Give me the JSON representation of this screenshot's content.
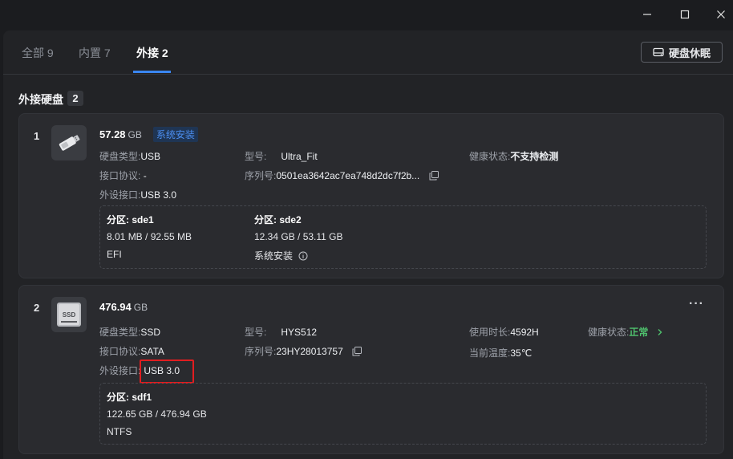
{
  "window": {
    "minimize_glyph": "—",
    "maximize_glyph": "☐",
    "close_glyph": "✕"
  },
  "tabs": [
    {
      "label": "全部 9"
    },
    {
      "label": "内置 7"
    },
    {
      "label": "外接 2"
    }
  ],
  "toolbar": {
    "sleep_label": "硬盘休眠",
    "sleep_icon": "drive-icon"
  },
  "section": {
    "title": "外接硬盘",
    "count": "2"
  },
  "drives": [
    {
      "index": "1",
      "size": "57.28",
      "unit": "GB",
      "badge": "系统安装",
      "icon": "usb-stick-icon",
      "disk_type_label": "硬盘类型:",
      "disk_type": "USB",
      "protocol_label": "接口协议:",
      "protocol": "-",
      "port_label": "外设接口:",
      "port": "USB 3.0",
      "model_label": "型号:",
      "model": "Ultra_Fit",
      "serial_label": "序列号:",
      "serial": "0501ea3642ac7ea748d2dc7f2b...",
      "health_label": "健康状态:",
      "health": "不支持检测",
      "partitions": [
        {
          "name_label": "分区:",
          "name": "sde1",
          "usage": "8.01 MB / 92.55 MB",
          "fs": "EFI"
        },
        {
          "name_label": "分区:",
          "name": "sde2",
          "usage": "12.34 GB / 53.11 GB",
          "fs": "系统安装"
        }
      ]
    },
    {
      "index": "2",
      "size": "476.94",
      "unit": "GB",
      "icon": "ssd-icon",
      "icon_text": "SSD",
      "disk_type_label": "硬盘类型:",
      "disk_type": "SSD",
      "protocol_label": "接口协议:",
      "protocol": "SATA",
      "port_label": "外设接口:",
      "port": "USB 3.0",
      "model_label": "型号:",
      "model": "HYS512",
      "serial_label": "序列号:",
      "serial": "23HY28013757",
      "uptime_label": "使用时长:",
      "uptime": "4592H",
      "temp_label": "当前温度:",
      "temp": "35℃",
      "health_label": "健康状态:",
      "health": "正常",
      "more": "···",
      "partitions": [
        {
          "name_label": "分区:",
          "name": "sdf1",
          "usage": "122.65 GB / 476.94 GB",
          "fs": "NTFS"
        }
      ]
    }
  ],
  "colors": {
    "accent": "#3a86f0",
    "ok": "#4fc06d",
    "highlight": "#e11d20",
    "badge_text": "#4c8ef0"
  }
}
